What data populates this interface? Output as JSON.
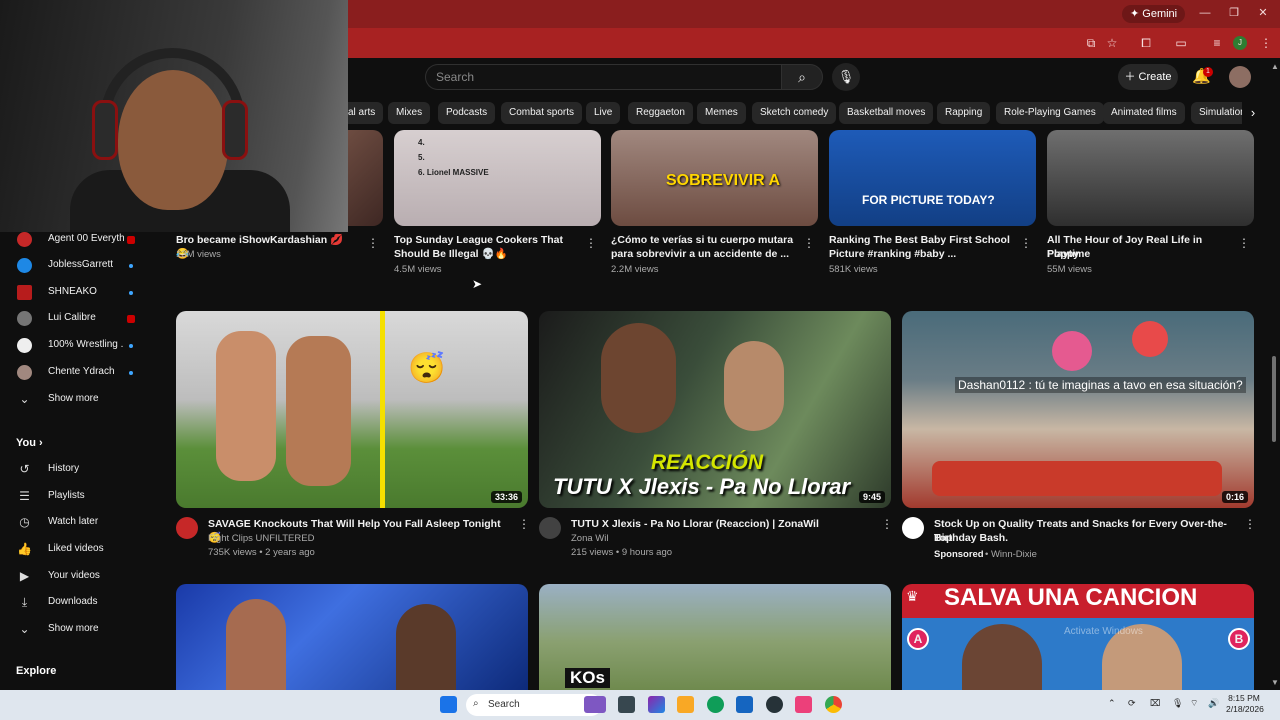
{
  "browser": {
    "gemini_label": "Gemini",
    "window_controls": {
      "minimize": "—",
      "restore": "❐",
      "close": "✕"
    }
  },
  "youtube": {
    "search_placeholder": "Search",
    "create_label": "Create",
    "notification_count": "1"
  },
  "chips": [
    "al arts",
    "Mixes",
    "Podcasts",
    "Combat sports",
    "Live",
    "Reggaeton",
    "Memes",
    "Sketch comedy",
    "Basketball moves",
    "Rapping",
    "Role-Playing Games",
    "Animated films",
    "Simulation"
  ],
  "sidebar": {
    "subscriptions": [
      {
        "label": "Agent 00 Everyth...",
        "color": "#c62828",
        "status": "live"
      },
      {
        "label": "JoblessGarrett",
        "color": "#1e88e5",
        "status": "dot"
      },
      {
        "label": "SHNEAKO",
        "color": "#b71c1c",
        "status": "dot"
      },
      {
        "label": "Lui Calibre",
        "color": "#757575",
        "status": "live"
      },
      {
        "label": "100% Wrestling ...",
        "color": "#eeeeee",
        "status": "dot"
      },
      {
        "label": "Chente Ydrach",
        "color": "#a1887f",
        "status": "dot"
      }
    ],
    "show_more_1": "Show more",
    "you_header": "You",
    "you_items": [
      {
        "label": "History",
        "icon": "history-icon"
      },
      {
        "label": "Playlists",
        "icon": "playlists-icon"
      },
      {
        "label": "Watch later",
        "icon": "watch-later-icon"
      },
      {
        "label": "Liked videos",
        "icon": "like-icon"
      },
      {
        "label": "Your videos",
        "icon": "your-videos-icon"
      },
      {
        "label": "Downloads",
        "icon": "download-icon"
      }
    ],
    "show_more_2": "Show more",
    "explore_header": "Explore"
  },
  "row1": [
    {
      "title": "Bro became iShowKardashian 💋😂",
      "title2": "",
      "meta": "13M views"
    },
    {
      "title": "Top Sunday League Cookers That",
      "title2": "Should Be Illegal 💀🔥",
      "meta": "4.5M views",
      "thumb_lines": [
        "4.",
        "5.",
        "6.  Lionel MASSIVE"
      ]
    },
    {
      "title": "¿Cómo te verías si tu cuerpo mutara",
      "title2": "para sobrevivir a un accidente de ...",
      "meta": "2.2M views",
      "thumb_text": "SOBREVIVIR A"
    },
    {
      "title": "Ranking The Best Baby First School",
      "title2": "Picture #ranking #baby ...",
      "meta": "581K views",
      "thumb_text": "FOR PICTURE TODAY?"
    },
    {
      "title": "All The Hour of Joy Real Life in Poppy",
      "title2": "Playtime",
      "meta": "55M views"
    }
  ],
  "row2": [
    {
      "title": "SAVAGE Knockouts That Will Help You Fall Asleep Tonight 😴",
      "channel": "Fight Clips UNFILTERED",
      "meta": "735K views • 2 years ago",
      "duration": "33:36"
    },
    {
      "title": "TUTU X Jlexis - Pa No Llorar (Reaccion) | ZonaWil",
      "channel": "Zona Wil",
      "meta": "215 views • 9 hours ago",
      "duration": "9:45",
      "thumb_text_1": "REACCIÓN",
      "thumb_text_2": "TUTU X Jlexis - Pa No Llorar"
    },
    {
      "title": "Stock Up on Quality Treats and Snacks for Every Over-the-Top",
      "title2": "Birthday Bash.",
      "sponsored": "Sponsored",
      "advertiser": "• Winn-Dixie",
      "duration": "0:16",
      "overlay": "Dashan0112 : tú te imaginas a tavo en esa situación?"
    }
  ],
  "row3": [
    {
      "thumb_text": ""
    },
    {
      "thumb_text": "KOs"
    },
    {
      "thumb_text": "SALVA UNA CANCION",
      "badge_a": "A",
      "badge_b": "B",
      "watermark": "Activate Windows"
    }
  ],
  "taskbar": {
    "search_label": "Search",
    "time": "8:15 PM",
    "date": "2/18/2026"
  }
}
